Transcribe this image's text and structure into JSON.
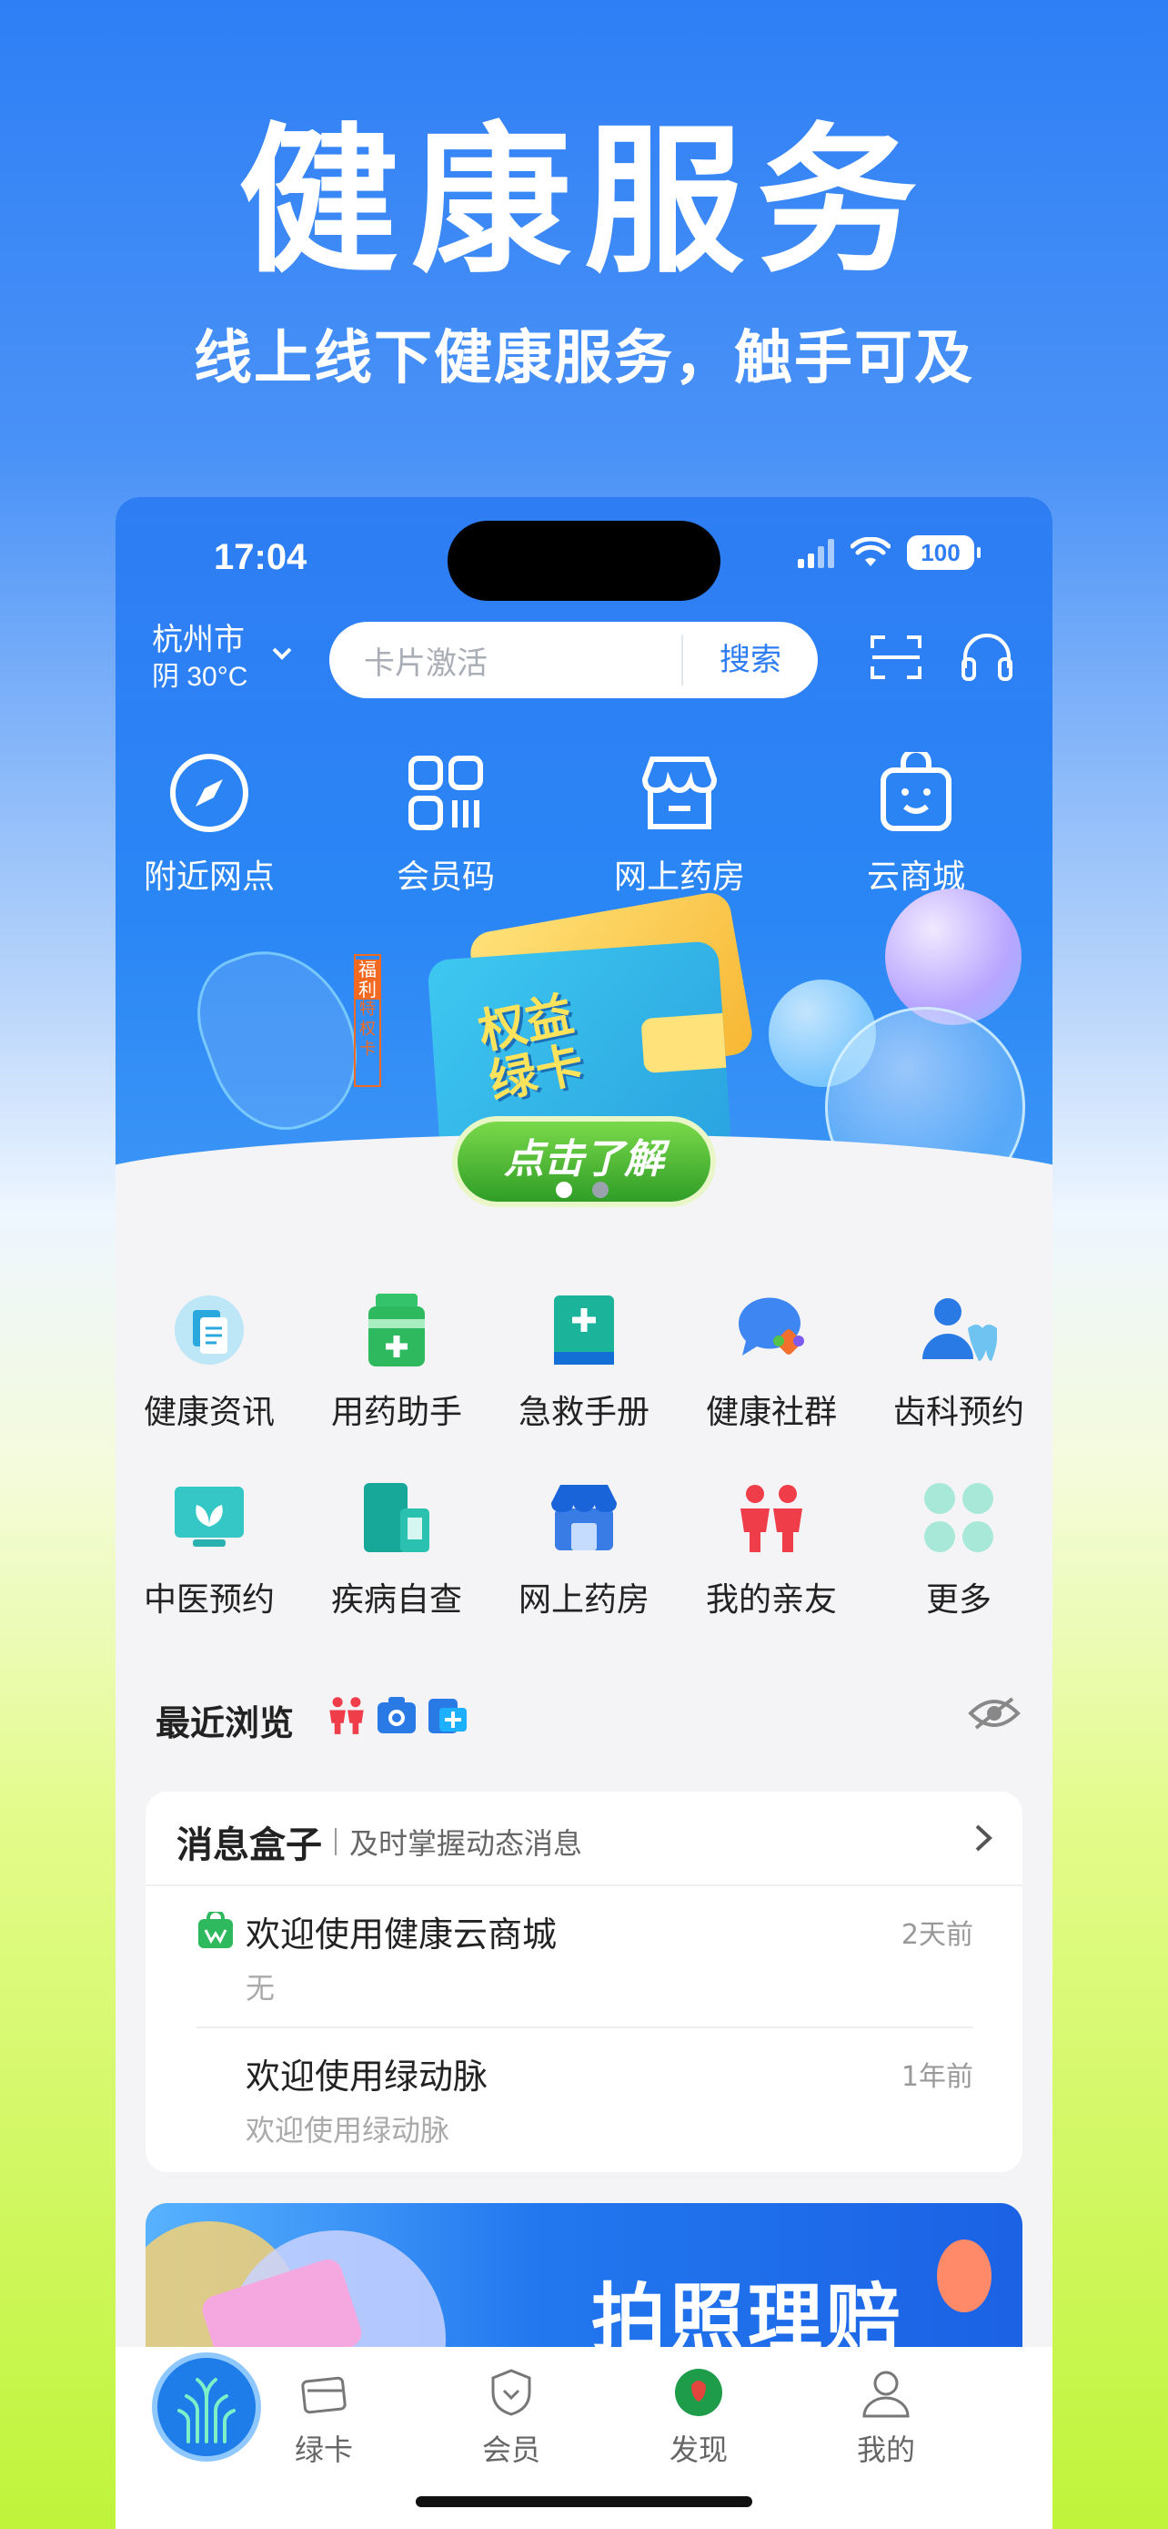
{
  "hero": {
    "title": "健康服务",
    "subtitle": "线上线下健康服务，触手可及"
  },
  "status": {
    "time": "17:04",
    "battery": "100"
  },
  "location": {
    "city": "杭州市",
    "weather": "阴 30°C"
  },
  "search": {
    "placeholder": "卡片激活",
    "button": "搜索"
  },
  "quick_actions": [
    {
      "label": "附近网点",
      "icon": "compass-icon"
    },
    {
      "label": "会员码",
      "icon": "qr-code-icon"
    },
    {
      "label": "网上药房",
      "icon": "store-icon"
    },
    {
      "label": "云商城",
      "icon": "shopping-bag-icon"
    }
  ],
  "banner": {
    "card_text_1": "权益",
    "card_text_2": "绿卡",
    "cta": "点击了解",
    "tag_top": "福利",
    "tag_bottom": "特权卡"
  },
  "services": [
    {
      "label": "健康资讯",
      "icon": "news-icon"
    },
    {
      "label": "用药助手",
      "icon": "medicine-icon"
    },
    {
      "label": "急救手册",
      "icon": "first-aid-book-icon"
    },
    {
      "label": "健康社群",
      "icon": "chat-group-icon"
    },
    {
      "label": "齿科预约",
      "icon": "dental-icon"
    },
    {
      "label": "中医预约",
      "icon": "tcm-icon"
    },
    {
      "label": "疾病自查",
      "icon": "self-check-icon"
    },
    {
      "label": "网上药房",
      "icon": "pharmacy-icon"
    },
    {
      "label": "我的亲友",
      "icon": "family-icon"
    },
    {
      "label": "更多",
      "icon": "more-icon"
    }
  ],
  "recent": {
    "title": "最近浏览"
  },
  "messages": {
    "title": "消息盒子",
    "subtitle": "及时掌握动态消息",
    "items": [
      {
        "title": "欢迎使用健康云商城",
        "sub": "无",
        "time": "2天前"
      },
      {
        "title": "欢迎使用绿动脉",
        "sub": "欢迎使用绿动脉",
        "time": "1年前"
      }
    ]
  },
  "promo": {
    "text": "拍照理赔"
  },
  "tabs": [
    {
      "label": "绿卡"
    },
    {
      "label": "会员"
    },
    {
      "label": "发现"
    },
    {
      "label": "我的"
    }
  ],
  "colors": {
    "primary": "#2f7df3",
    "accent_green": "#34b44a"
  }
}
